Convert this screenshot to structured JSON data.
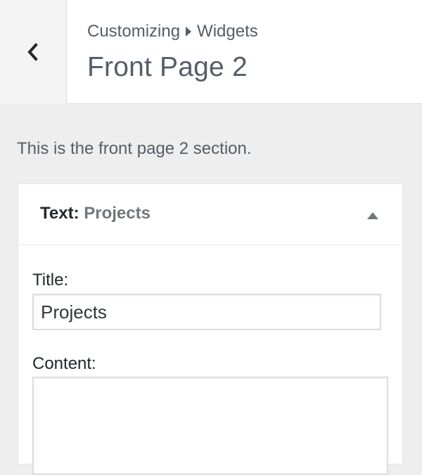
{
  "header": {
    "breadcrumb": {
      "parent": "Customizing",
      "current": "Widgets"
    },
    "title": "Front Page 2",
    "back_icon": "chevron-left-icon"
  },
  "section": {
    "description": "This is the front page 2 section."
  },
  "widget": {
    "type_label": "Text",
    "separator": ":",
    "title_value": "Projects",
    "toggle_icon": "triangle-up-icon",
    "fields": {
      "title_label": "Title:",
      "title_value": "Projects",
      "content_label": "Content:",
      "content_value": ""
    }
  },
  "colors": {
    "background": "#eeeeee",
    "panel": "#ffffff",
    "text": "#23282d",
    "muted": "#555d66",
    "border": "#dddddd"
  }
}
